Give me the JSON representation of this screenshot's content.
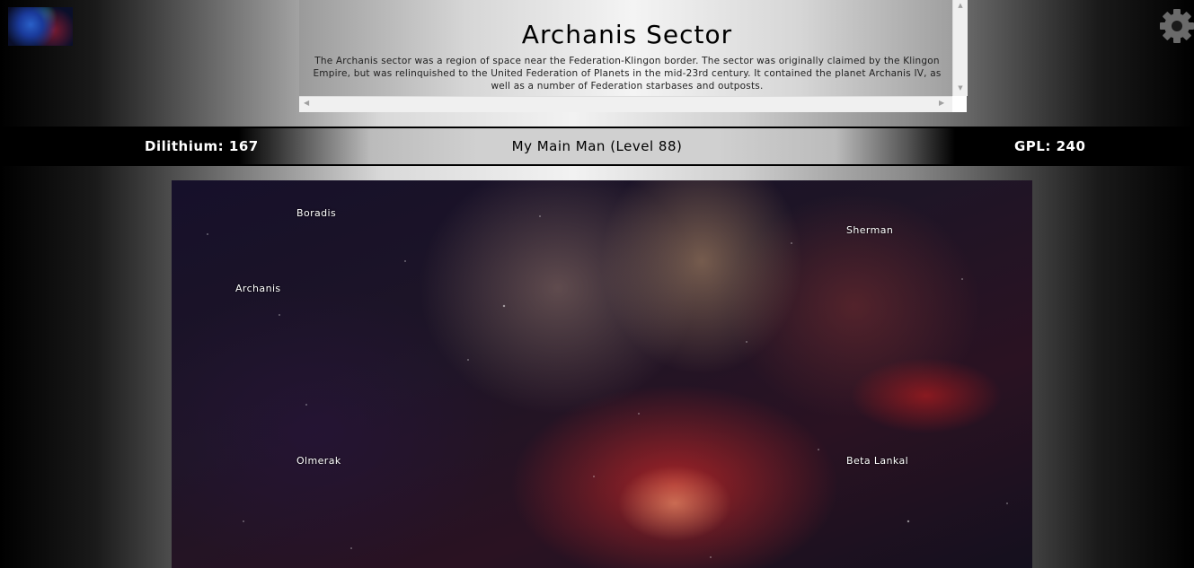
{
  "header": {
    "title": "Archanis Sector",
    "description": "The Archanis sector was a region of space near the Federation-Klingon border. The sector was originally claimed by the Klingon Empire, but was relinquished to the United Federation of Planets in the mid-23rd century. It contained the planet Archanis IV, as well as a number of Federation starbases and outposts."
  },
  "status": {
    "dilithium": "Dilithium: 167",
    "player": "My Main Man (Level 88)",
    "gpl": "GPL: 240"
  },
  "map": {
    "planets": {
      "boradis": "Boradis",
      "archanis": "Archanis",
      "sherman": "Sherman",
      "olmerak": "Olmerak",
      "beta_lankal": "Beta Lankal"
    }
  },
  "icons": {
    "thumbnail": "sector-thumbnail-icon",
    "settings": "gear-icon"
  }
}
